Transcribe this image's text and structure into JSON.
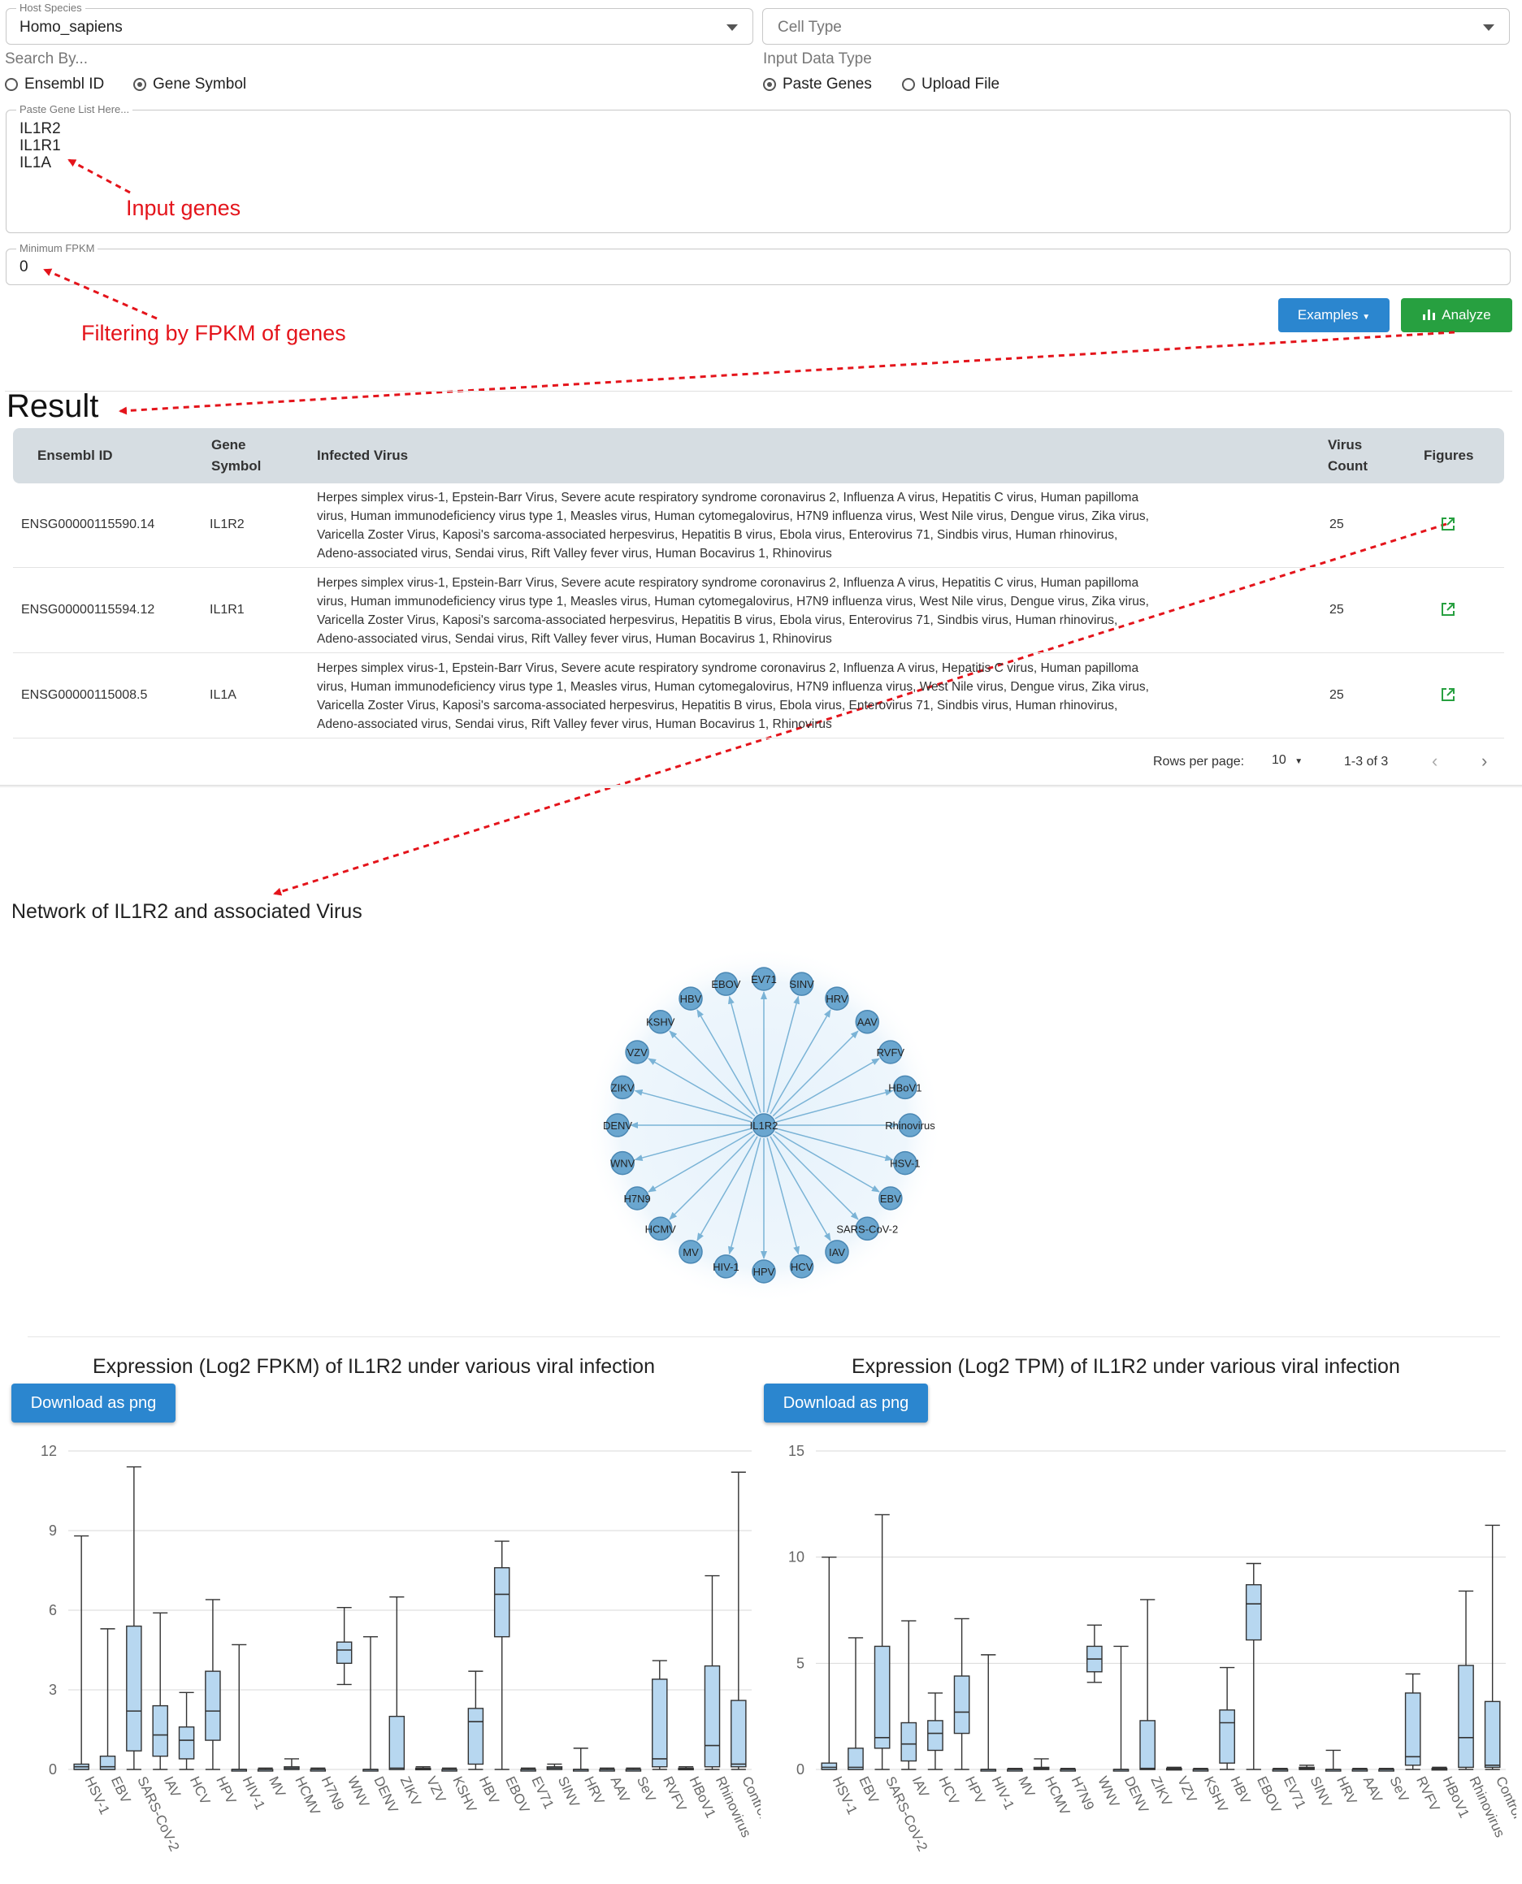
{
  "form": {
    "host_species": {
      "label": "Host Species",
      "value": "Homo_sapiens"
    },
    "cell_type": {
      "placeholder": "Cell Type"
    },
    "search_by": {
      "label": "Search By...",
      "options": [
        "Ensembl ID",
        "Gene Symbol"
      ],
      "selected": "Gene Symbol"
    },
    "input_type": {
      "label": "Input Data Type",
      "options": [
        "Paste Genes",
        "Upload File"
      ],
      "selected": "Paste Genes"
    },
    "gene_list": {
      "label": "Paste Gene List Here...",
      "lines": [
        "IL1R2",
        "IL1R1",
        "IL1A"
      ]
    },
    "min_fpkm": {
      "label": "Minimum FPKM",
      "value": "0"
    },
    "examples_label": "Examples",
    "analyze_label": "Analyze"
  },
  "annotations": {
    "input_genes": "Input genes",
    "filtering": "Filtering by FPKM of genes"
  },
  "result": {
    "title": "Result",
    "headers": {
      "ensembl": "Ensembl ID",
      "gene_l1": "Gene",
      "gene_l2": "Symbol",
      "virus": "Infected Virus",
      "count_l1": "Virus",
      "count_l2": "Count",
      "figures": "Figures"
    },
    "rows": [
      {
        "ensembl": "ENSG00000115590.14",
        "symbol": "IL1R2",
        "count": "25",
        "virus_lines": [
          "Herpes simplex virus-1, Epstein-Barr Virus, Severe acute respiratory syndrome coronavirus 2, Influenza A virus, Hepatitis C virus, Human papilloma",
          "virus, Human immunodeficiency virus type 1, Measles virus, Human cytomegalovirus, H7N9 influenza virus, West Nile virus, Dengue virus, Zika virus,",
          "Varicella Zoster Virus, Kaposi's sarcoma-associated herpesvirus, Hepatitis B virus, Ebola virus, Enterovirus 71, Sindbis virus, Human rhinovirus,",
          "Adeno-associated virus, Sendai virus, Rift Valley fever virus, Human Bocavirus 1, Rhinovirus"
        ]
      },
      {
        "ensembl": "ENSG00000115594.12",
        "symbol": "IL1R1",
        "count": "25",
        "virus_lines": [
          "Herpes simplex virus-1, Epstein-Barr Virus, Severe acute respiratory syndrome coronavirus 2, Influenza A virus, Hepatitis C virus, Human papilloma",
          "virus, Human immunodeficiency virus type 1, Measles virus, Human cytomegalovirus, H7N9 influenza virus, West Nile virus, Dengue virus, Zika virus,",
          "Varicella Zoster Virus, Kaposi's sarcoma-associated herpesvirus, Hepatitis B virus, Ebola virus, Enterovirus 71, Sindbis virus, Human rhinovirus,",
          "Adeno-associated virus, Sendai virus, Rift Valley fever virus, Human Bocavirus 1, Rhinovirus"
        ]
      },
      {
        "ensembl": "ENSG00000115008.5",
        "symbol": "IL1A",
        "count": "25",
        "virus_lines": [
          "Herpes simplex virus-1, Epstein-Barr Virus, Severe acute respiratory syndrome coronavirus 2, Influenza A virus, Hepatitis C virus, Human papilloma",
          "virus, Human immunodeficiency virus type 1, Measles virus, Human cytomegalovirus, H7N9 influenza virus, West Nile virus, Dengue virus, Zika virus,",
          "Varicella Zoster Virus, Kaposi's sarcoma-associated herpesvirus, Hepatitis B virus, Ebola virus, Enterovirus 71, Sindbis virus, Human rhinovirus,",
          "Adeno-associated virus, Sendai virus, Rift Valley fever virus, Human Bocavirus 1, Rhinovirus"
        ]
      }
    ],
    "pagination": {
      "rows_label": "Rows per page:",
      "rows_value": "10",
      "range": "1-3 of 3"
    }
  },
  "network": {
    "title": "Network of IL1R2 and associated Virus",
    "center": "IL1R2",
    "nodes": [
      "EV71",
      "SINV",
      "HRV",
      "AAV",
      "RVFV",
      "HBoV1",
      "Rhinovirus",
      "HSV-1",
      "EBV",
      "SARS-CoV-2",
      "IAV",
      "HCV",
      "HPV",
      "HIV-1",
      "MV",
      "HCMV",
      "H7N9",
      "WNV",
      "DENV",
      "ZIKV",
      "VZV",
      "KSHV",
      "HBV",
      "EBOV"
    ]
  },
  "charts": {
    "download_label": "Download as png",
    "icon_colors": {
      "export": "#27a040",
      "accent": "#2b86cf"
    }
  },
  "chart_data": [
    {
      "type": "box",
      "title": "Expression (Log2 FPKM) of IL1R2 under various viral infection",
      "categories": [
        "HSV-1",
        "EBV",
        "SARS-CoV-2",
        "IAV",
        "HCV",
        "HPV",
        "HIV-1",
        "MV",
        "HCMV",
        "H7N9",
        "WNV",
        "DENV",
        "ZIKV",
        "VZV",
        "KSHV",
        "HBV",
        "EBOV",
        "EV71",
        "SINV",
        "HRV",
        "AAV",
        "SeV",
        "RVFV",
        "HBoV1",
        "Rhinovirus",
        "Control"
      ],
      "ylim": [
        0,
        12
      ],
      "yticks": [
        0,
        3,
        6,
        9,
        12
      ],
      "boxes": [
        [
          0,
          0,
          0.1,
          0.2,
          8.8
        ],
        [
          0,
          0,
          0.1,
          0.5,
          5.3
        ],
        [
          0,
          0.7,
          2.2,
          5.4,
          11.4
        ],
        [
          0,
          0.5,
          1.3,
          2.4,
          5.9
        ],
        [
          0,
          0.4,
          1.1,
          1.6,
          2.9
        ],
        [
          0,
          1.1,
          2.2,
          3.7,
          6.4
        ],
        [
          0,
          0,
          0,
          0,
          4.7
        ],
        [
          0,
          0,
          0,
          0,
          0.05
        ],
        [
          0,
          0,
          0.05,
          0.1,
          0.4
        ],
        [
          0,
          0,
          0,
          0,
          0.05
        ],
        [
          3.2,
          4.0,
          4.5,
          4.8,
          6.1
        ],
        [
          0,
          0,
          0,
          0,
          5.0
        ],
        [
          0,
          0,
          0.05,
          2.0,
          6.5
        ],
        [
          0,
          0,
          0.02,
          0.05,
          0.1
        ],
        [
          0,
          0,
          0,
          0,
          0.05
        ],
        [
          0,
          0.2,
          1.8,
          2.3,
          3.7
        ],
        [
          0,
          5.0,
          6.6,
          7.6,
          8.6
        ],
        [
          0,
          0,
          0,
          0,
          0.05
        ],
        [
          0,
          0,
          0.05,
          0.1,
          0.2
        ],
        [
          0,
          0,
          0,
          0,
          0.8
        ],
        [
          0,
          0,
          0,
          0,
          0.05
        ],
        [
          0,
          0,
          0,
          0,
          0.05
        ],
        [
          0,
          0.1,
          0.4,
          3.4,
          4.1
        ],
        [
          0,
          0,
          0.02,
          0.05,
          0.1
        ],
        [
          0,
          0.1,
          0.9,
          3.9,
          7.3
        ],
        [
          0,
          0.1,
          0.2,
          2.6,
          11.2
        ]
      ]
    },
    {
      "type": "box",
      "title": "Expression (Log2 TPM) of IL1R2 under various viral infection",
      "categories": [
        "HSV-1",
        "EBV",
        "SARS-CoV-2",
        "IAV",
        "HCV",
        "HPV",
        "HIV-1",
        "MV",
        "HCMV",
        "H7N9",
        "WNV",
        "DENV",
        "ZIKV",
        "VZV",
        "KSHV",
        "HBV",
        "EBOV",
        "EV71",
        "SINV",
        "HRV",
        "AAV",
        "SeV",
        "RVFV",
        "HBoV1",
        "Rhinovirus",
        "Control"
      ],
      "ylim": [
        0,
        15
      ],
      "yticks": [
        0,
        5,
        10,
        15
      ],
      "boxes": [
        [
          0,
          0,
          0.1,
          0.3,
          10.0
        ],
        [
          0,
          0,
          0.1,
          1.0,
          6.2
        ],
        [
          0,
          1.0,
          1.5,
          5.8,
          12.0
        ],
        [
          0,
          0.4,
          1.2,
          2.2,
          7.0
        ],
        [
          0,
          0.9,
          1.7,
          2.3,
          3.6
        ],
        [
          0,
          1.7,
          2.7,
          4.4,
          7.1
        ],
        [
          0,
          0,
          0,
          0,
          5.4
        ],
        [
          0,
          0,
          0,
          0,
          0.05
        ],
        [
          0,
          0,
          0.05,
          0.1,
          0.5
        ],
        [
          0,
          0,
          0,
          0,
          0.05
        ],
        [
          4.1,
          4.6,
          5.2,
          5.8,
          6.8
        ],
        [
          0,
          0,
          0,
          0,
          5.8
        ],
        [
          0,
          0,
          0.05,
          2.3,
          8.0
        ],
        [
          0,
          0,
          0.02,
          0.05,
          0.1
        ],
        [
          0,
          0,
          0,
          0,
          0.05
        ],
        [
          0,
          0.3,
          2.2,
          2.8,
          4.8
        ],
        [
          0,
          6.1,
          7.8,
          8.7,
          9.7
        ],
        [
          0,
          0,
          0,
          0,
          0.05
        ],
        [
          0,
          0,
          0.05,
          0.1,
          0.2
        ],
        [
          0,
          0,
          0,
          0,
          0.9
        ],
        [
          0,
          0,
          0,
          0,
          0.05
        ],
        [
          0,
          0,
          0,
          0,
          0.05
        ],
        [
          0,
          0.2,
          0.6,
          3.6,
          4.5
        ],
        [
          0,
          0,
          0.02,
          0.05,
          0.1
        ],
        [
          0,
          0.1,
          1.5,
          4.9,
          8.4
        ],
        [
          0,
          0.1,
          0.2,
          3.2,
          11.5
        ]
      ]
    }
  ]
}
